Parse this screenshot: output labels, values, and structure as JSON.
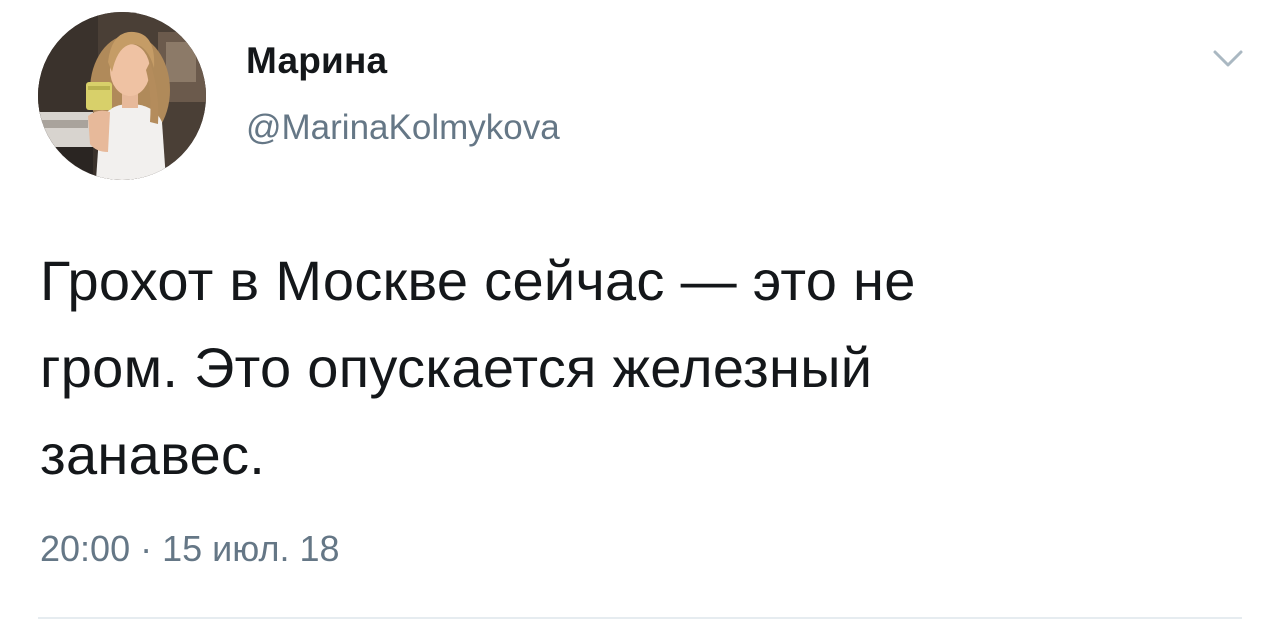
{
  "tweet": {
    "author": {
      "display_name": "Марина",
      "handle": "@MarinaKolmykova",
      "avatar_icon": "profile-photo"
    },
    "menu_icon": "chevron-down-icon",
    "text": "Грохот в Москве сейчас — это не\nгром. Это опускается железный\nзанавес.",
    "time": "20:00",
    "separator": "·",
    "date": "15 июл. 18"
  },
  "colors": {
    "text": "#14171a",
    "secondary": "#657786",
    "divider": "#e6ecf0",
    "chevron": "#aab8c2"
  }
}
